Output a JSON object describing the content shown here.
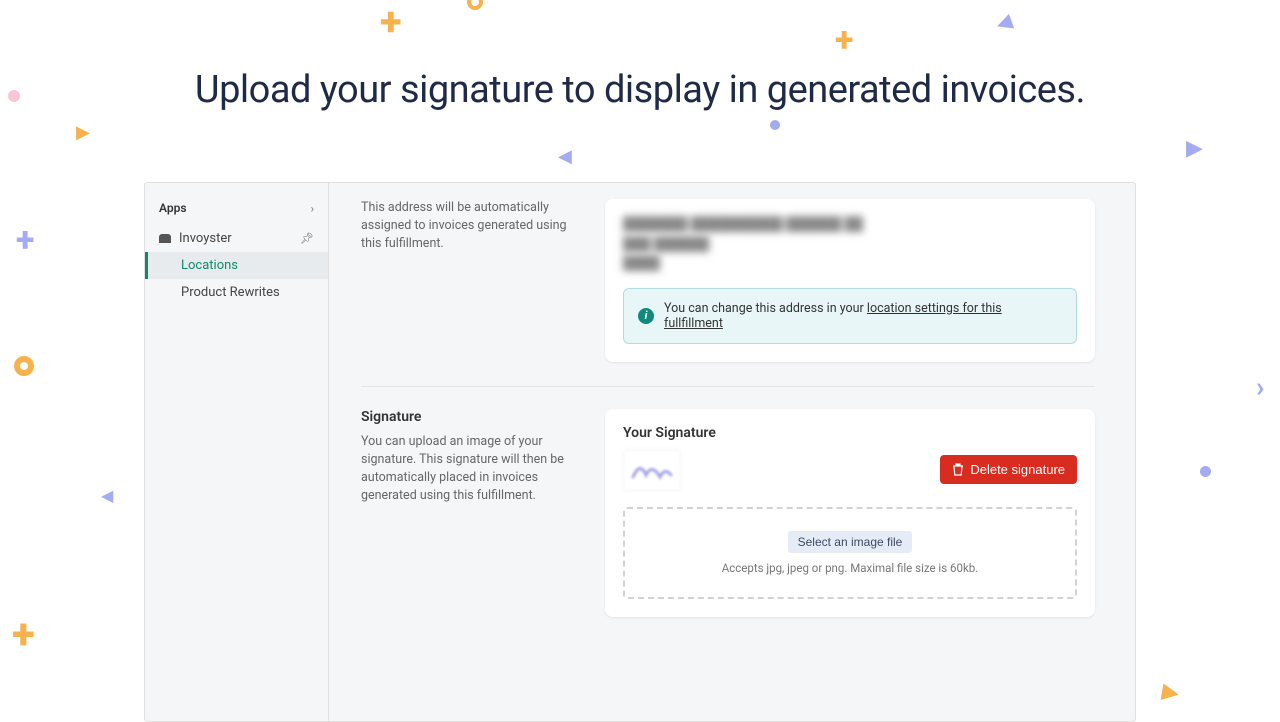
{
  "headline": "Upload your signature to display in generated invoices.",
  "sidebar": {
    "header": "Apps",
    "items": [
      {
        "label": "Invoyster"
      },
      {
        "label": "Locations"
      },
      {
        "label": "Product Rewrites"
      }
    ]
  },
  "address_section": {
    "desc": "This address will be automatically assigned to invoices generated using this fulfillment.",
    "blur_line1": "███████ ██████████ ██████ ██",
    "blur_line2": "███ ██████",
    "blur_line3": "████",
    "info_prefix": "You can change this address in your ",
    "info_link": "location settings for this fullfillment"
  },
  "signature_section": {
    "title": "Signature",
    "desc": "You can upload an image of your signature. This signature will then be automatically placed in invoices generated using this fulfillment.",
    "card_title": "Your Signature",
    "delete_label": "Delete signature",
    "select_label": "Select an image file",
    "hint": "Accepts jpg, jpeg or png. Maximal file size is 60kb."
  }
}
